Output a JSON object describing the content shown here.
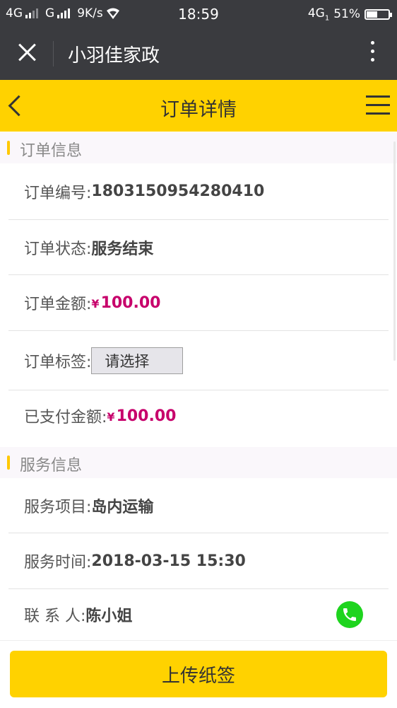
{
  "status_bar": {
    "network1": "4G",
    "network2": "G",
    "speed": "9K/s",
    "time": "18:59",
    "network3": "4G",
    "network3_sub": "1",
    "battery": "51%",
    "battery_level": 0.51
  },
  "wechat_bar": {
    "title": "小羽佳家政"
  },
  "header": {
    "title": "订单详情"
  },
  "order_section": {
    "title": "订单信息",
    "order_no_label": "订单编号:",
    "order_no": "1803150954280410",
    "status_label": "订单状态:",
    "status": "服务结束",
    "amount_label": "订单金额:",
    "amount_currency": "¥",
    "amount": "100.00",
    "tag_label": "订单标签:",
    "tag_select": "请选择",
    "paid_label": "已支付金额:",
    "paid_currency": "¥",
    "paid": "100.00"
  },
  "service_section": {
    "title": "服务信息",
    "item_label": "服务项目:",
    "item": "岛内运输",
    "time_label": "服务时间:",
    "time": "2018-03-15 15:30",
    "contact_label": "联 系 人:",
    "contact": "陈小姐"
  },
  "footer": {
    "upload_label": "上传纸签"
  },
  "colors": {
    "accent": "#ffd200",
    "money": "#c7006b",
    "phone": "#1ed41e",
    "dark_bar": "#3a3b3f"
  },
  "icons": [
    "wifi-icon",
    "close-icon",
    "more-icon",
    "back-icon",
    "menu-icon",
    "phone-icon"
  ]
}
